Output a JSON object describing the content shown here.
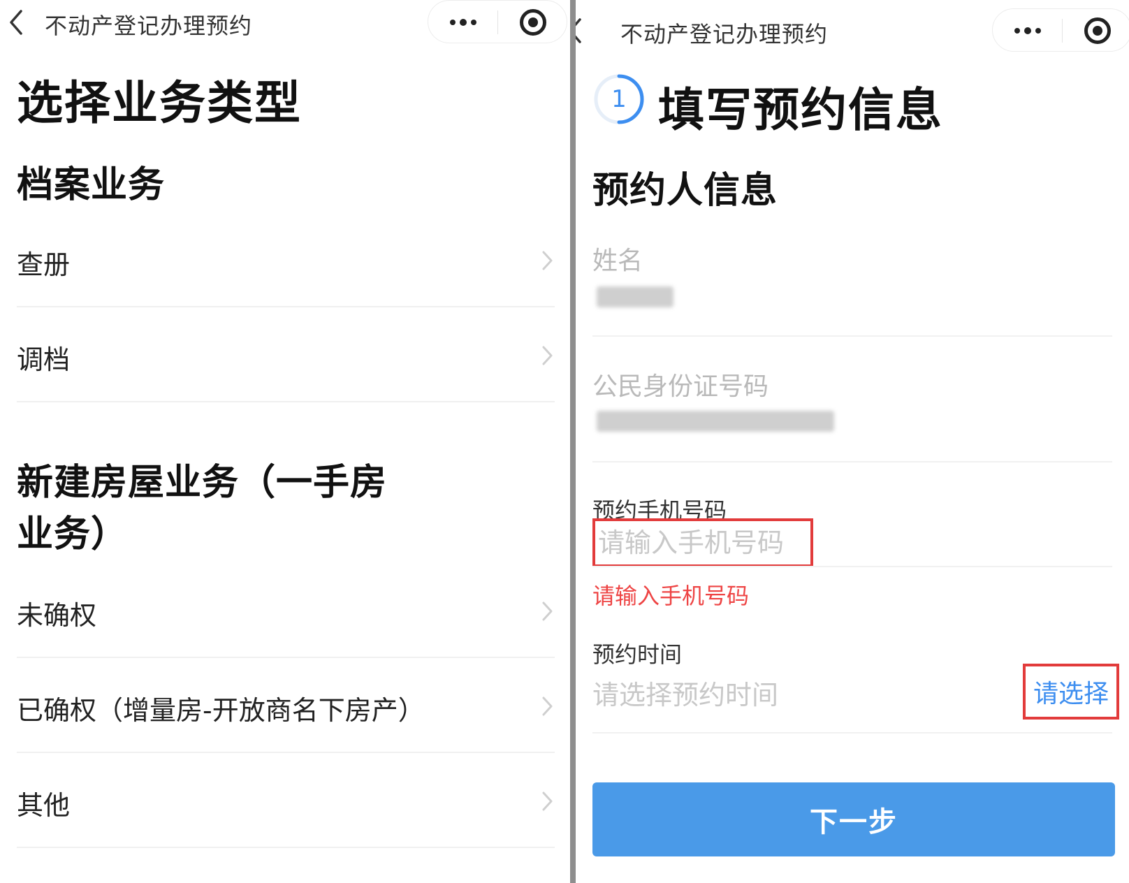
{
  "left": {
    "nav_title": "不动产登记办理预约",
    "page_title": "选择业务类型",
    "sections": [
      {
        "title": "档案业务",
        "items": [
          "查册",
          "调档"
        ]
      },
      {
        "title_line1": "新建房屋业务（一手房",
        "title_line2": "业务）",
        "items": [
          "未确权",
          "已确权（增量房-开放商名下房产）",
          "其他"
        ]
      }
    ]
  },
  "right": {
    "nav_title": "不动产登记办理预约",
    "step_number": "1",
    "page_title": "填写预约信息",
    "section_title": "预约人信息",
    "name_label": "姓名",
    "id_label": "公民身份证号码",
    "phone_label": "预约手机号码",
    "phone_placeholder": "请输入手机号码",
    "phone_error": "请输入手机号码",
    "time_label": "预约时间",
    "time_placeholder": "请选择预约时间",
    "select_label": "请选择",
    "next_label": "下一步"
  },
  "icons": [
    "back-chevron-icon",
    "more-dots-icon",
    "close-target-icon",
    "chevron-right-icon",
    "step-progress-ring-icon"
  ],
  "colors": {
    "accent": "#4a9ae8",
    "error": "#ee4444",
    "highlight_border": "#e23b3b",
    "divider": "#8e8e8e"
  }
}
